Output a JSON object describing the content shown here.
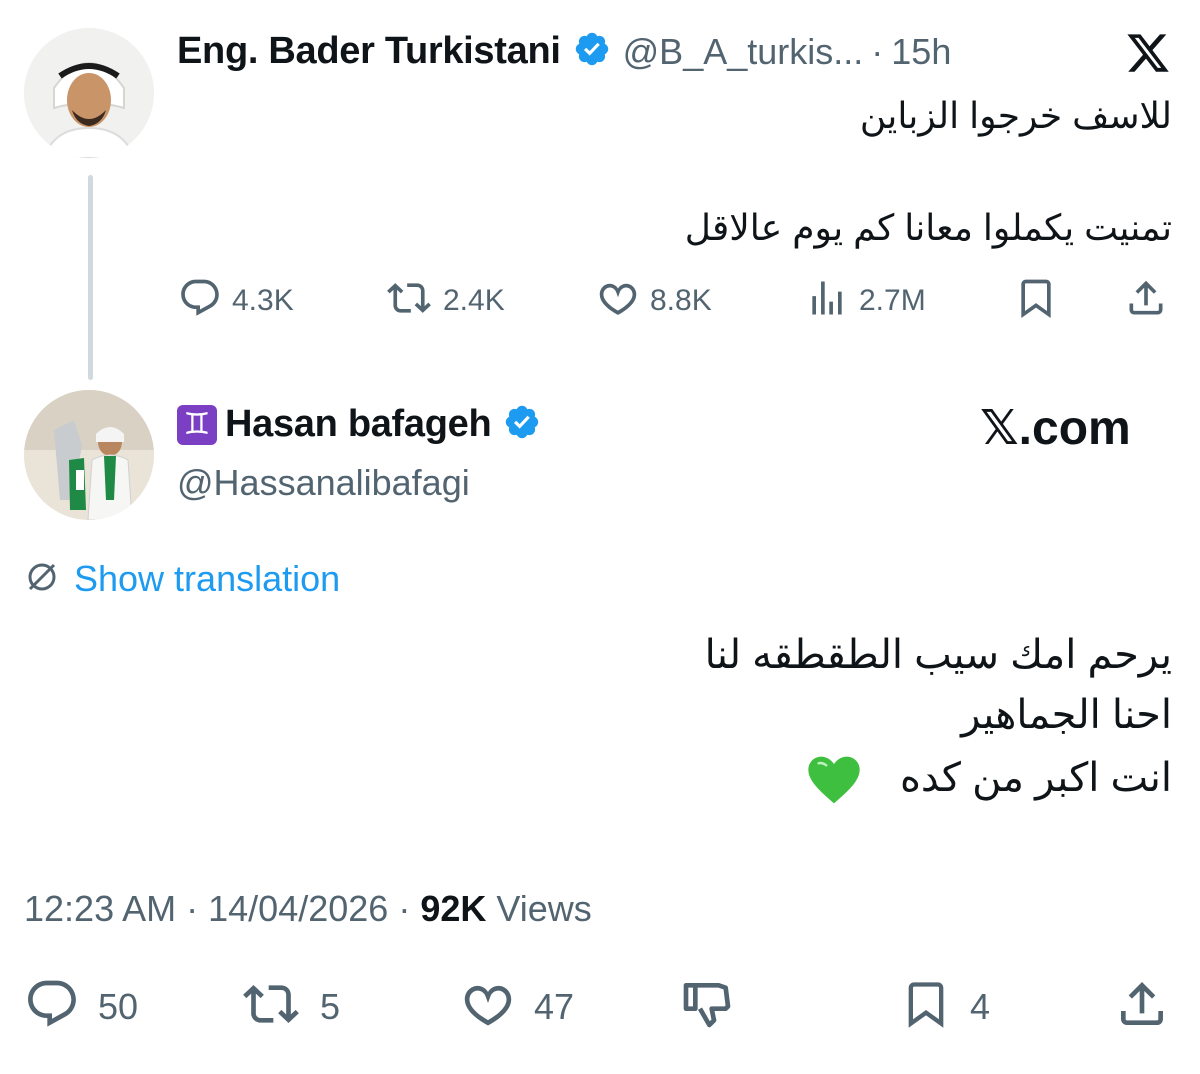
{
  "parent_tweet": {
    "display_name": "Eng. Bader Turkistani",
    "handle": "@B_A_turkis...",
    "separator": "·",
    "time_ago": "15h",
    "text_lines": [
      "للاسف خرجوا الزباين",
      "تمنيت يكملوا معانا كم يوم عالاقل"
    ],
    "replies": "4.3K",
    "retweets": "2.4K",
    "likes": "8.8K",
    "views": "2.7M"
  },
  "brand": {
    "x_logo": "x-logo-icon",
    "site_label": "𝕏.com"
  },
  "reply_tweet": {
    "name_emoji": "♊",
    "display_name": "Hasan bafageh",
    "handle": "@Hassanalibafagi",
    "show_translation": "Show translation",
    "text_lines": [
      "يرحم امك سيب الطقطقه لنا",
      "احنا الجماهير",
      "انت اكبر من كده"
    ],
    "heart_emoji": "💚",
    "time": "12:23 AM",
    "sep": "·",
    "date": "14/04/2026",
    "views_count": "92K",
    "views_label": "Views",
    "replies": "50",
    "retweets": "5",
    "likes": "47",
    "bookmarks": "4"
  },
  "colors": {
    "verified_blue": "#1d9bf0",
    "muted": "#536471",
    "link": "#1d9bf0",
    "heart_green": "#3fbf3f"
  }
}
